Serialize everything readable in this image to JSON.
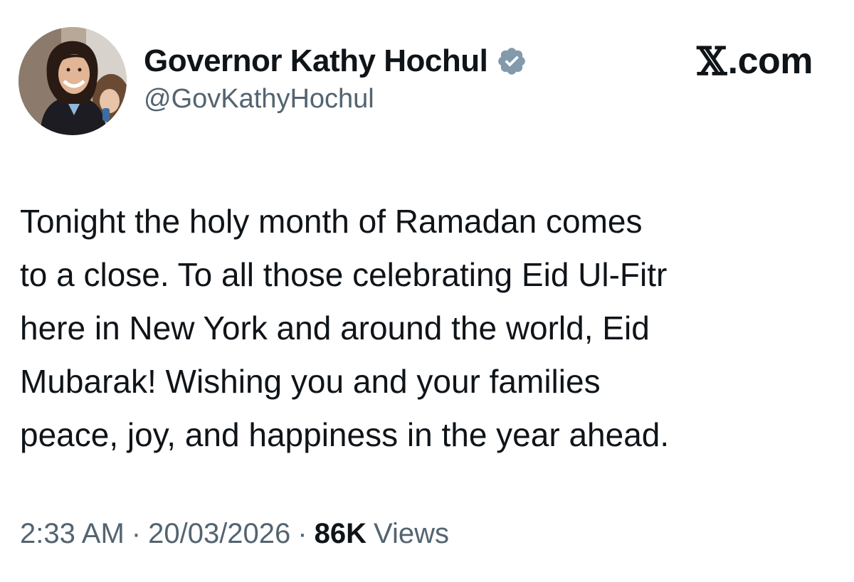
{
  "author": {
    "display_name": "Governor Kathy Hochul",
    "handle": "@GovKathyHochul",
    "verified_badge": "verified-badge-icon",
    "badge_color": "#829aab"
  },
  "source": {
    "logo_mark": "𝕏",
    "logo_text": ".com"
  },
  "tweet": {
    "lines": [
      "Tonight the holy month of Ramadan comes",
      "to a close. To all those celebrating Eid Ul-Fitr",
      "here in New York and around the world, Eid",
      "Mubarak! Wishing you and your families",
      "peace, joy, and happiness in the year ahead."
    ]
  },
  "meta": {
    "time": "2:33 AM",
    "date": "20/03/2026",
    "separator": "·",
    "views_count": "86K",
    "views_label": "Views"
  },
  "colors": {
    "text_primary": "#0f1419",
    "text_secondary": "#536471",
    "background": "#ffffff"
  }
}
